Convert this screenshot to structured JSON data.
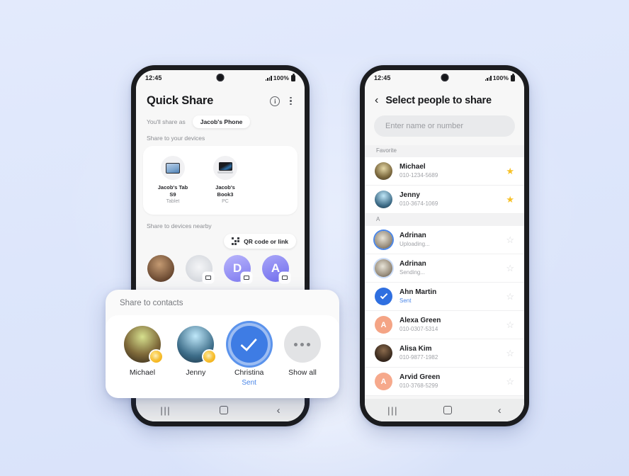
{
  "background": {
    "color": "#dde6fb"
  },
  "colors": {
    "accent": "#4a86e8",
    "selected": "#3e7ce4",
    "star_on": "#f7c127",
    "star_off": "#d6d7da"
  },
  "left_phone": {
    "status": {
      "time": "12:45",
      "battery": "100%",
      "signal_icon": "signal-bars-icon",
      "battery_icon": "battery-full-icon"
    },
    "header": {
      "title": "Quick Share",
      "info_icon": "info-icon",
      "menu_icon": "more-vertical-icon"
    },
    "share_as": {
      "label": "You'll share as",
      "device": "Jacob's Phone"
    },
    "your_devices": {
      "section_label": "Share to your devices",
      "items": [
        {
          "name": "Jacob's Tab S9",
          "type": "Tablet",
          "icon": "tablet-icon"
        },
        {
          "name": "Jacob's Book3",
          "type": "PC",
          "icon": "laptop-icon"
        }
      ]
    },
    "nearby": {
      "section_label": "Share to devices nearby",
      "qr_chip": {
        "label": "QR code or link",
        "icon": "qr-code-icon"
      },
      "devices": [
        {
          "initial": "",
          "kind": "photo",
          "color": "#8a6b52",
          "badge": "none"
        },
        {
          "initial": "",
          "kind": "photo",
          "color": "#dfe2e6",
          "badge": "cast-icon"
        },
        {
          "initial": "D",
          "kind": "letter",
          "color": "#8f8bf0",
          "badge": "cast-icon"
        },
        {
          "initial": "A",
          "kind": "letter",
          "color": "#7b7bef",
          "badge": "cast-icon"
        }
      ]
    },
    "nav": {
      "recent_icon": "recents-icon",
      "home_icon": "home-icon",
      "back_icon": "back-icon"
    }
  },
  "contacts_card": {
    "title": "Share to contacts",
    "items": [
      {
        "name": "Michael",
        "status": "",
        "state": "medal",
        "avatar": "photo-michael",
        "color": "#9ab86a"
      },
      {
        "name": "Jenny",
        "status": "",
        "state": "medal",
        "avatar": "photo-jenny",
        "color": "#7fc7e8"
      },
      {
        "name": "Christina",
        "status": "Sent",
        "state": "selected",
        "avatar": "check-icon",
        "color": "#3e7ce4"
      },
      {
        "name": "Show all",
        "status": "",
        "state": "more",
        "avatar": "more-icon",
        "color": "#e2e3e5"
      }
    ]
  },
  "right_phone": {
    "status": {
      "time": "12:45",
      "battery": "100%"
    },
    "header": {
      "title": "Select people to share",
      "back_icon": "chevron-left-icon"
    },
    "search": {
      "placeholder": "Enter name or number",
      "value": ""
    },
    "sections": [
      {
        "label": "Favorite",
        "contacts": [
          {
            "name": "Michael",
            "sub": "010-1234-5689",
            "sub_kind": "number",
            "starred": true,
            "avatar_kind": "photo",
            "color": "#b4d48a",
            "initial": "",
            "state": "none"
          },
          {
            "name": "Jenny",
            "sub": "010-3674-1069",
            "sub_kind": "number",
            "starred": true,
            "avatar_kind": "photo",
            "color": "#8fd0ef",
            "initial": "",
            "state": "none"
          }
        ]
      },
      {
        "label": "A",
        "contacts": [
          {
            "name": "Adrinan",
            "sub": "Uploading...",
            "sub_kind": "status",
            "starred": false,
            "avatar_kind": "photo",
            "color": "#cfd6e0",
            "initial": "",
            "state": "uploading"
          },
          {
            "name": "Adrinan",
            "sub": "Sending...",
            "sub_kind": "status",
            "starred": false,
            "avatar_kind": "photo",
            "color": "#cfd6e0",
            "initial": "",
            "state": "sending"
          },
          {
            "name": "Ahn Martin",
            "sub": "Sent",
            "sub_kind": "sent",
            "starred": false,
            "avatar_kind": "check",
            "color": "#2f6fe0",
            "initial": "",
            "state": "sent"
          },
          {
            "name": "Alexa Green",
            "sub": "010-0307-5314",
            "sub_kind": "number",
            "starred": false,
            "avatar_kind": "letter",
            "color": "#f4a485",
            "initial": "A",
            "state": "none"
          },
          {
            "name": "Alisa Kim",
            "sub": "010-9877-1982",
            "sub_kind": "number",
            "starred": false,
            "avatar_kind": "photo",
            "color": "#3a2f2a",
            "initial": "",
            "state": "none"
          },
          {
            "name": "Arvid Green",
            "sub": "010-3768-5299",
            "sub_kind": "number",
            "starred": false,
            "avatar_kind": "letter",
            "color": "#f6a98c",
            "initial": "A",
            "state": "none"
          }
        ]
      }
    ],
    "nav": {
      "recent_icon": "recents-icon",
      "home_icon": "home-icon",
      "back_icon": "back-icon"
    }
  },
  "glyphs": {
    "star_filled": "★",
    "star_outline": "☆",
    "chevron_left": "‹",
    "chevron_back": "‹",
    "info": "i"
  }
}
